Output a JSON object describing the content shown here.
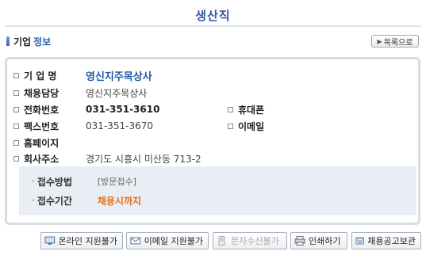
{
  "header": {
    "title": "생산직"
  },
  "section": {
    "title_a": "기업",
    "title_b": "정보"
  },
  "list_button": {
    "icon": "triangle-right-icon",
    "label": "목록으로"
  },
  "info": {
    "company": {
      "label": "기 업 명",
      "value": "영신지주목상사"
    },
    "manager": {
      "label": "채용담당",
      "value": "영신지주목상사"
    },
    "phone": {
      "label": "전화번호",
      "value": "031-351-3610"
    },
    "mobile": {
      "label": "휴대폰",
      "value": ""
    },
    "fax": {
      "label": "팩스번호",
      "value": "031-351-3670"
    },
    "email": {
      "label": "이메일",
      "value": ""
    },
    "homepage": {
      "label": "홈페이지",
      "value": ""
    },
    "address": {
      "label": "회사주소",
      "value": "경기도 시흥시 미산동 713-2"
    }
  },
  "apply": {
    "method": {
      "label": "접수방법",
      "value": "[방문접수]"
    },
    "deadline": {
      "label": "접수기간",
      "value": "채용시까지"
    }
  },
  "actions": [
    {
      "label": "온라인 지원불가",
      "icon": "monitor-icon",
      "enabled": true
    },
    {
      "label": "이메일 지원불가",
      "icon": "envelope-icon",
      "enabled": true
    },
    {
      "label": "문자수신불가",
      "icon": "phone-message-icon",
      "enabled": false
    },
    {
      "label": "인쇄하기",
      "icon": "printer-icon",
      "enabled": true
    },
    {
      "label": "채용공고보관",
      "icon": "archive-icon",
      "enabled": true
    }
  ],
  "colors": {
    "title": "#2c5a9e",
    "company": "#1f5aa8",
    "deadline": "#e0701a",
    "panel": "#e9eef5"
  }
}
